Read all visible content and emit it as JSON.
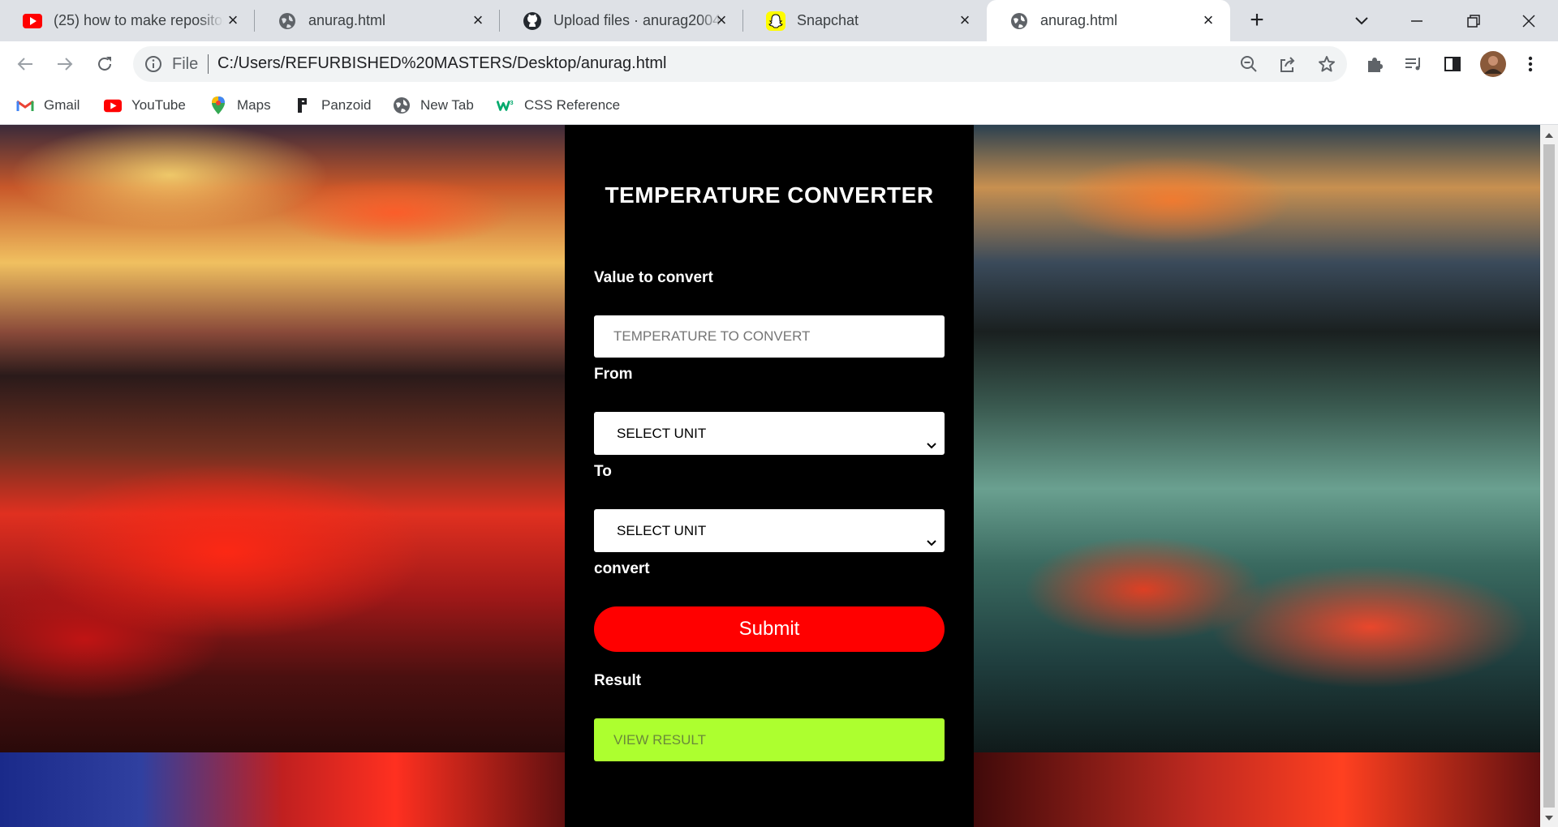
{
  "browser": {
    "tabs": [
      {
        "title": "(25) how to make repository",
        "icon": "youtube-icon"
      },
      {
        "title": "anurag.html",
        "icon": "globe-icon"
      },
      {
        "title": "Upload files · anurag2004",
        "icon": "github-icon"
      },
      {
        "title": "Snapchat",
        "icon": "snapchat-icon"
      },
      {
        "title": "anurag.html",
        "icon": "globe-icon",
        "active": true
      }
    ],
    "address": {
      "scheme_label": "File",
      "url": "C:/Users/REFURBISHED%20MASTERS/Desktop/anurag.html"
    },
    "bookmarks": [
      {
        "label": "Gmail",
        "icon": "gmail-icon"
      },
      {
        "label": "YouTube",
        "icon": "youtube-icon"
      },
      {
        "label": "Maps",
        "icon": "maps-icon"
      },
      {
        "label": "Panzoid",
        "icon": "panzoid-icon"
      },
      {
        "label": "New Tab",
        "icon": "globe-icon"
      },
      {
        "label": "CSS Reference",
        "icon": "w3schools-icon"
      }
    ]
  },
  "converter": {
    "title": "TEMPERATURE CONVERTER",
    "value_label": "Value to convert",
    "value_placeholder": "TEMPERATURE TO CONVERT",
    "from_label": "From",
    "from_select": "SELECT UNIT",
    "to_label": "To",
    "to_select": "SELECT UNIT",
    "convert_label": "convert",
    "submit_label": "Submit",
    "result_label": "Result",
    "result_value": "VIEW RESULT"
  },
  "colors": {
    "panel_bg": "#000000",
    "submit_bg": "#ff0000",
    "result_bg": "#adff2f"
  }
}
